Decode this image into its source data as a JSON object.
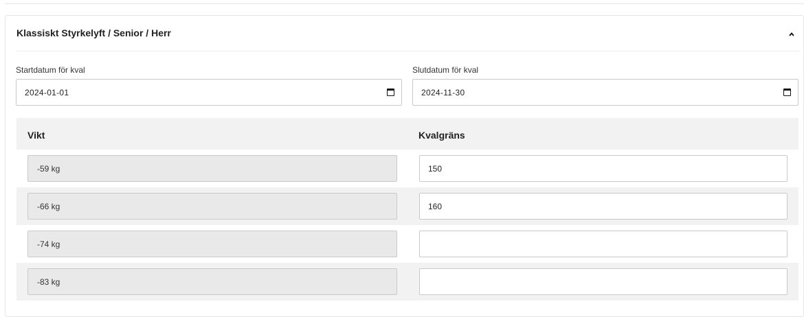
{
  "section": {
    "title": "Klassiskt Styrkelyft / Senior / Herr",
    "collapse_icon": "chevron-up-icon"
  },
  "dates": {
    "start": {
      "label": "Startdatum för kval",
      "value": "2024-01-01"
    },
    "end": {
      "label": "Slutdatum för kval",
      "value": "2024-11-30"
    }
  },
  "table": {
    "headers": {
      "weight": "Vikt",
      "limit": "Kvalgräns"
    },
    "rows": [
      {
        "weight": "-59 kg",
        "limit": "150"
      },
      {
        "weight": "-66 kg",
        "limit": "160"
      },
      {
        "weight": "-74 kg",
        "limit": ""
      },
      {
        "weight": "-83 kg",
        "limit": ""
      }
    ]
  }
}
